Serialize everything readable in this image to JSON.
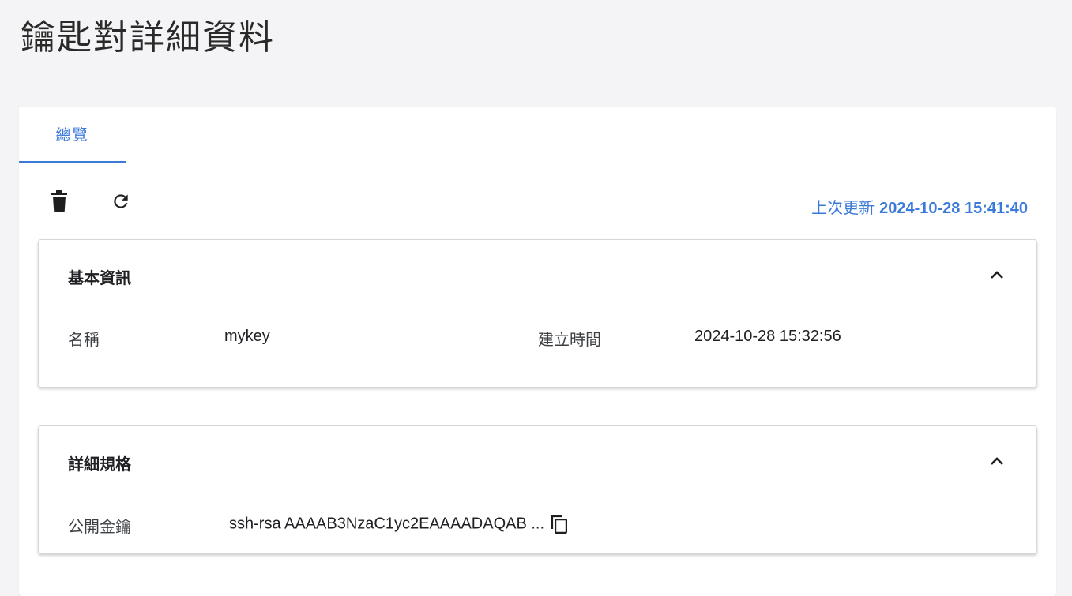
{
  "page": {
    "title": "鑰匙對詳細資料"
  },
  "tabs": [
    {
      "label": "總覽",
      "active": true
    }
  ],
  "toolbar": {
    "delete_icon": "trash-icon",
    "refresh_icon": "refresh-icon",
    "last_updated_label": "上次更新",
    "last_updated_value": "2024-10-28 15:41:40"
  },
  "basic_info": {
    "title": "基本資訊",
    "name_label": "名稱",
    "name_value": "mykey",
    "created_label": "建立時間",
    "created_value": "2024-10-28 15:32:56"
  },
  "spec": {
    "title": "詳細規格",
    "public_key_label": "公開金鑰",
    "public_key_value": "ssh-rsa AAAAB3NzaC1yc2EAAAADAQAB ...",
    "copy_icon": "copy-icon"
  },
  "colors": {
    "accent": "#3b7ad9",
    "background": "#f4f4f6"
  }
}
